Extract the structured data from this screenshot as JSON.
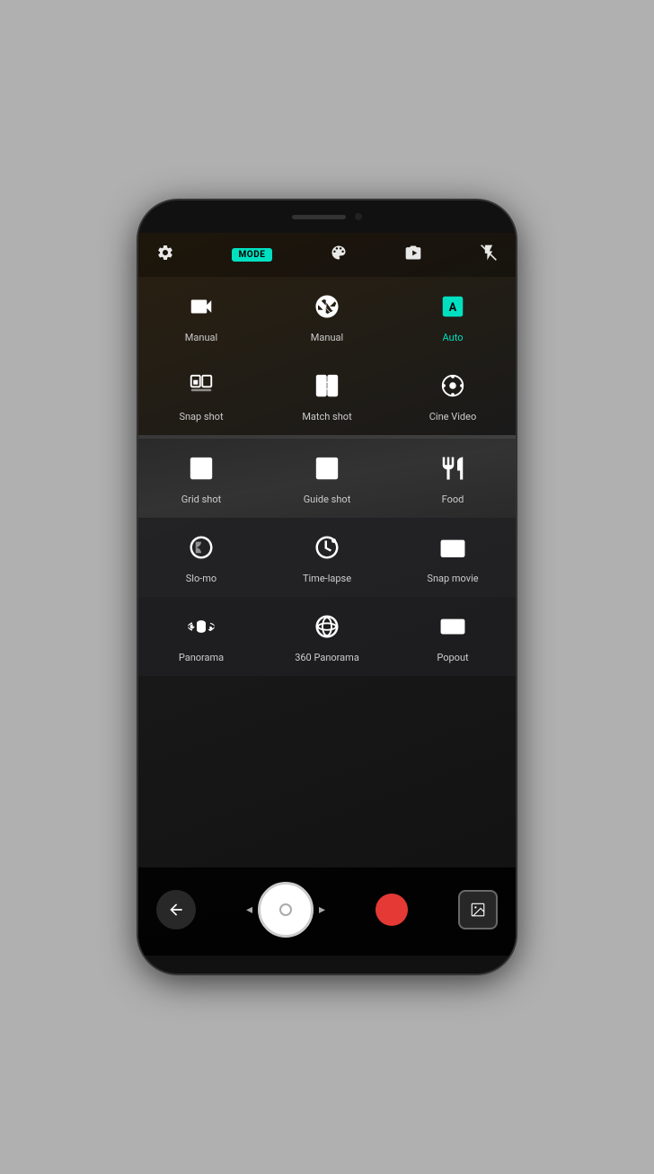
{
  "phone": {
    "toolbar": {
      "settings_label": "settings",
      "mode_badge": "MODE",
      "effects_label": "effects",
      "flip_label": "flip-camera",
      "flash_label": "flash-off"
    },
    "modes": [
      {
        "id": "manual-video",
        "icon": "video",
        "label": "Manual",
        "active": false,
        "row": 0
      },
      {
        "id": "manual-photo",
        "icon": "aperture",
        "label": "Manual",
        "active": false,
        "row": 0
      },
      {
        "id": "auto",
        "icon": "auto",
        "label": "Auto",
        "active": true,
        "row": 0
      },
      {
        "id": "snap-shot",
        "icon": "snap",
        "label": "Snap shot",
        "active": false,
        "row": 1
      },
      {
        "id": "match-shot",
        "icon": "match",
        "label": "Match shot",
        "active": false,
        "row": 1
      },
      {
        "id": "cine-video",
        "icon": "cine",
        "label": "Cine Video",
        "active": false,
        "row": 1
      },
      {
        "id": "grid-shot",
        "icon": "grid",
        "label": "Grid shot",
        "active": false,
        "row": 2
      },
      {
        "id": "guide-shot",
        "icon": "guide",
        "label": "Guide shot",
        "active": false,
        "row": 2
      },
      {
        "id": "food",
        "icon": "food",
        "label": "Food",
        "active": false,
        "row": 2
      },
      {
        "id": "slo-mo",
        "icon": "slomo",
        "label": "Slo-mo",
        "active": false,
        "row": 3
      },
      {
        "id": "time-lapse",
        "icon": "timelapse",
        "label": "Time-lapse",
        "active": false,
        "row": 3
      },
      {
        "id": "snap-movie",
        "icon": "snapmovie",
        "label": "Snap movie",
        "active": false,
        "row": 3
      },
      {
        "id": "panorama",
        "icon": "panorama",
        "label": "Panorama",
        "active": false,
        "row": 4
      },
      {
        "id": "360-panorama",
        "icon": "panorama360",
        "label": "360 Panorama",
        "active": false,
        "row": 4
      },
      {
        "id": "popout",
        "icon": "popout",
        "label": "Popout",
        "active": false,
        "row": 4
      }
    ],
    "controls": {
      "back_label": "back",
      "record_label": "record",
      "gallery_label": "gallery"
    }
  }
}
